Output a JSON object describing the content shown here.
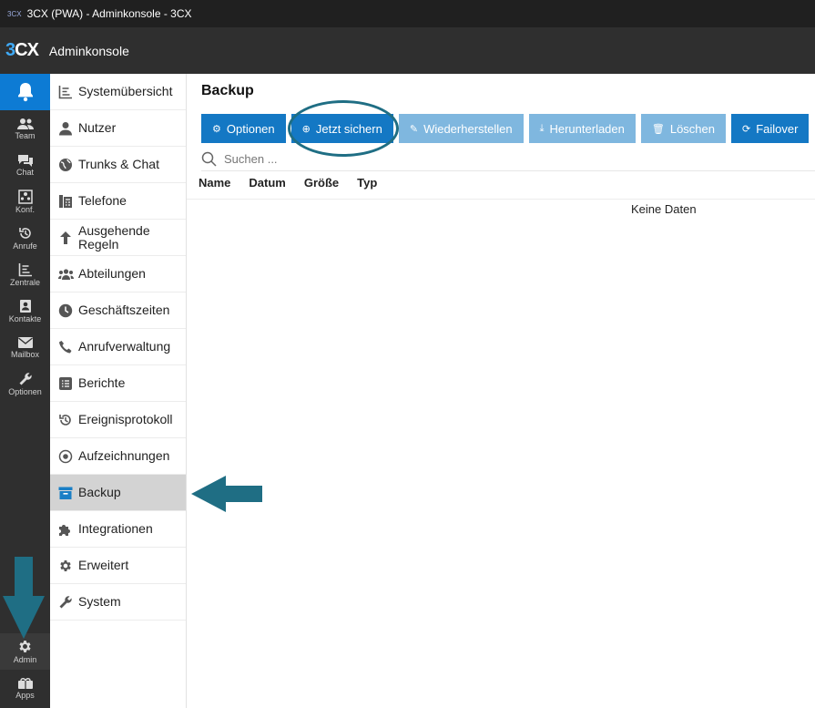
{
  "window": {
    "title": "3CX (PWA) - Adminkonsole - 3CX"
  },
  "header": {
    "logo_a": "3",
    "logo_b": "CX",
    "title": "Adminkonsole"
  },
  "rail": {
    "items": [
      {
        "label": "Team",
        "icon": "team-icon"
      },
      {
        "label": "Chat",
        "icon": "chat-icon"
      },
      {
        "label": "Konf.",
        "icon": "conference-icon"
      },
      {
        "label": "Anrufe",
        "icon": "history-icon"
      },
      {
        "label": "Zentrale",
        "icon": "chart-icon"
      },
      {
        "label": "Kontakte",
        "icon": "contacts-icon"
      },
      {
        "label": "Mailbox",
        "icon": "mail-icon"
      },
      {
        "label": "Optionen",
        "icon": "wrench-icon"
      }
    ],
    "bottom": [
      {
        "label": "Admin",
        "icon": "gear-icon"
      },
      {
        "label": "Apps",
        "icon": "apps-icon"
      }
    ]
  },
  "nav": {
    "items": [
      {
        "label": "Systemübersicht"
      },
      {
        "label": "Nutzer"
      },
      {
        "label": "Trunks & Chat"
      },
      {
        "label": "Telefone"
      },
      {
        "label": "Ausgehende Regeln"
      },
      {
        "label": "Abteilungen"
      },
      {
        "label": "Geschäftszeiten"
      },
      {
        "label": "Anrufverwaltung"
      },
      {
        "label": "Berichte"
      },
      {
        "label": "Ereignisprotokoll"
      },
      {
        "label": "Aufzeichnungen"
      },
      {
        "label": "Backup"
      },
      {
        "label": "Integrationen"
      },
      {
        "label": "Erweitert"
      },
      {
        "label": "System"
      }
    ],
    "active": "Backup"
  },
  "main": {
    "title": "Backup",
    "toolbar": {
      "options": "Optionen",
      "backup_now": "Jetzt sichern",
      "restore": "Wiederherstellen",
      "download": "Herunterladen",
      "delete": "Löschen",
      "failover": "Failover"
    },
    "search": {
      "placeholder": "Suchen ..."
    },
    "table": {
      "columns": [
        "Name",
        "Datum",
        "Größe",
        "Typ"
      ],
      "empty": "Keine Daten"
    }
  },
  "colors": {
    "accent": "#1478c4",
    "annotation": "#1f6e84",
    "rail_bg": "#2f2f2f"
  }
}
